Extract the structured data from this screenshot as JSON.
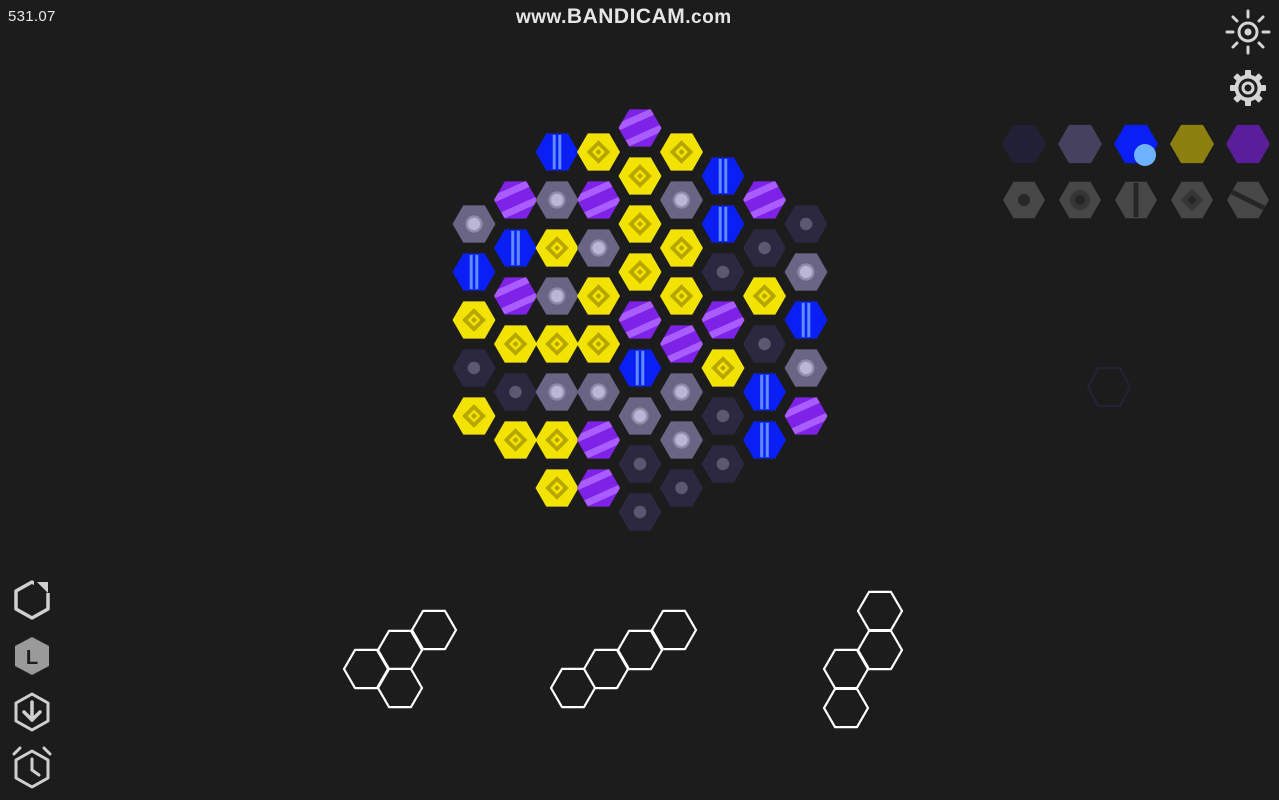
{
  "hud": {
    "score": "531.07",
    "watermark_prefix": "www.",
    "watermark_brand": "BANDICAM",
    "watermark_suffix": ".com"
  },
  "icons": {
    "top_right": [
      "brightness-icon",
      "settings-gear-icon"
    ],
    "left_toolbar": [
      "rotate-icon",
      "level-icon",
      "download-icon",
      "timer-icon"
    ],
    "level_letter": "L"
  },
  "colors": {
    "background": "#1c1c1c",
    "dark": "#2b2840",
    "gray": "#6a6585",
    "blue": "#0a1ff5",
    "yellow": "#f2e400",
    "purple": "#7e22e8"
  },
  "palette": {
    "swatches": [
      "dark",
      "gray",
      "blue",
      "yellow",
      "purple"
    ],
    "selected": "blue",
    "patterns": [
      "dot",
      "ring",
      "stripe-vertical",
      "diamond",
      "stripe-diagonal"
    ]
  },
  "board": {
    "columns": [
      [
        "gray",
        "blue",
        "yellow",
        "dark",
        "yellow"
      ],
      [
        "purple",
        "blue",
        "purple",
        "yellow",
        "dark",
        "yellow"
      ],
      [
        "blue",
        "gray",
        "yellow",
        "gray",
        "yellow",
        "gray",
        "yellow",
        "yellow"
      ],
      [
        "yellow",
        "purple",
        "gray",
        "yellow",
        "yellow",
        "gray",
        "purple",
        "purple"
      ],
      [
        "purple",
        "yellow",
        "yellow",
        "yellow",
        "purple",
        "blue",
        "gray",
        "dark",
        "dark"
      ],
      [
        "yellow",
        "gray",
        "yellow",
        "yellow",
        "purple",
        "gray",
        "gray",
        "dark"
      ],
      [
        "blue",
        "blue",
        "dark",
        "purple",
        "yellow",
        "dark",
        "dark"
      ],
      [
        "purple",
        "dark",
        "yellow",
        "dark",
        "blue",
        "blue"
      ],
      [
        "dark",
        "gray",
        "blue",
        "gray",
        "purple"
      ]
    ]
  },
  "pieces": [
    {
      "shape": "zigzag-4"
    },
    {
      "shape": "diagonal-4"
    },
    {
      "shape": "vertical-4"
    }
  ]
}
